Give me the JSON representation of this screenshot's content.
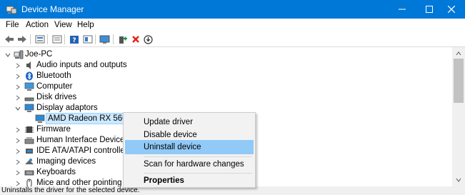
{
  "window": {
    "title": "Device Manager",
    "accent": "#0078d7",
    "app_icon": "device-manager-icon",
    "controls": {
      "minimize": "—",
      "maximize": "☐",
      "close": "✕"
    }
  },
  "menu": [
    "File",
    "Action",
    "View",
    "Help"
  ],
  "toolbar": {
    "icons": [
      "back-arrow-icon",
      "forward-arrow-icon",
      "properties-icon",
      "show-hidden-icon",
      "help-icon",
      "update-driver-icon",
      "scan-hardware-icon",
      "add-driver-icon",
      "uninstall-x-icon",
      "disable-device-icon"
    ]
  },
  "tree": {
    "root": "Joe-PC",
    "items": [
      {
        "label": "Audio inputs and outputs",
        "icon": "speaker-icon"
      },
      {
        "label": "Bluetooth",
        "icon": "bluetooth-icon"
      },
      {
        "label": "Computer",
        "icon": "computer-icon"
      },
      {
        "label": "Disk drives",
        "icon": "disk-drive-icon"
      },
      {
        "label": "Display adaptors",
        "icon": "display-adapter-icon",
        "expanded": true
      },
      {
        "label": "AMD Radeon RX 5600 XT",
        "icon": "gpu-icon",
        "child": true,
        "selected": true
      },
      {
        "label": "Firmware",
        "icon": "firmware-icon"
      },
      {
        "label": "Human Interface Devices",
        "icon": "hid-icon"
      },
      {
        "label": "IDE ATA/ATAPI controllers",
        "icon": "ide-controller-icon"
      },
      {
        "label": "Imaging devices",
        "icon": "camera-icon"
      },
      {
        "label": "Keyboards",
        "icon": "keyboard-icon"
      },
      {
        "label": "Mice and other pointing dev",
        "icon": "mouse-icon"
      }
    ]
  },
  "context_menu": {
    "items": [
      "Update driver",
      "Disable device",
      "Uninstall device",
      "Scan for hardware changes",
      "Properties"
    ],
    "highlighted": "Uninstall device",
    "highlight_color": "#91c9f7"
  },
  "status": "Uninstalls the driver for the selected device."
}
